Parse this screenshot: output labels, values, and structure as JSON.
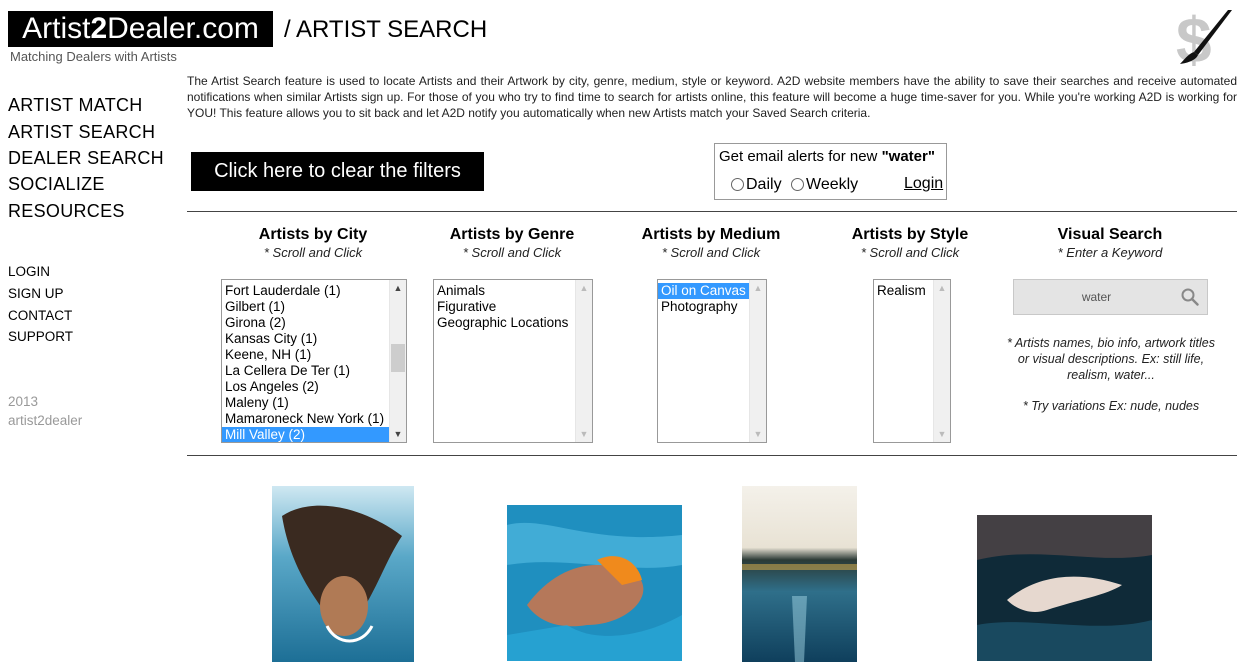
{
  "header": {
    "logo_part1": "Artist",
    "logo_part2": "2",
    "logo_part3": "Dealer.com",
    "tagline": "Matching Dealers with Artists",
    "page_heading": "/ ARTIST SEARCH"
  },
  "intro": "The Artist Search feature is used to locate Artists and their Artwork by city, genre, medium, style or keyword. A2D website members have the ability to save their searches and receive automated notifications when similar Artists sign up. For those of you who try to find time to search for artists online, this feature will become a huge time-saver for you. While you're working A2D is working for YOU! This feature allows you to sit back and let A2D notify you automatically when new Artists match your Saved Search criteria.",
  "nav": {
    "main": [
      "ARTIST MATCH",
      "ARTIST SEARCH",
      "DEALER SEARCH",
      "SOCIALIZE",
      "RESOURCES"
    ],
    "sub": [
      "LOGIN",
      "SIGN UP",
      "CONTACT",
      "SUPPORT"
    ],
    "year": "2013",
    "site_name": "artist2dealer"
  },
  "clear_filters_label": "Click here to clear the filters",
  "alerts": {
    "title_prefix": "Get email alerts for new ",
    "keyword": "\"water\"",
    "daily": "Daily",
    "weekly": "Weekly",
    "login": "Login"
  },
  "filters": {
    "city": {
      "heading": "Artists by City",
      "sub": "* Scroll and Click",
      "options": [
        "Fort Lauderdale (1)",
        "Gilbert (1)",
        "Girona (2)",
        "Kansas City (1)",
        "Keene, NH (1)",
        "La Cellera De Ter (1)",
        "Los Angeles (2)",
        "Maleny (1)",
        "Mamaroneck New York (1)",
        "Mill Valley (2)"
      ],
      "selected": "Mill Valley (2)"
    },
    "genre": {
      "heading": "Artists by Genre",
      "sub": "* Scroll and Click",
      "options": [
        "Animals",
        "Figurative",
        "Geographic Locations"
      ]
    },
    "medium": {
      "heading": "Artists by Medium",
      "sub": "* Scroll and Click",
      "options": [
        "Oil on Canvas",
        "Photography"
      ],
      "selected": "Oil on Canvas"
    },
    "style": {
      "heading": "Artists by Style",
      "sub": "* Scroll and Click",
      "options": [
        "Realism"
      ]
    },
    "visual": {
      "heading": "Visual Search",
      "sub": "* Enter a Keyword",
      "value": "water",
      "help": "* Artists names, bio info, artwork titles or visual descriptions. Ex: still life, realism, water...",
      "tip": "* Try variations Ex: nude, nudes"
    }
  },
  "colors": {
    "selection": "#3399ff",
    "accent_black": "#000000"
  }
}
